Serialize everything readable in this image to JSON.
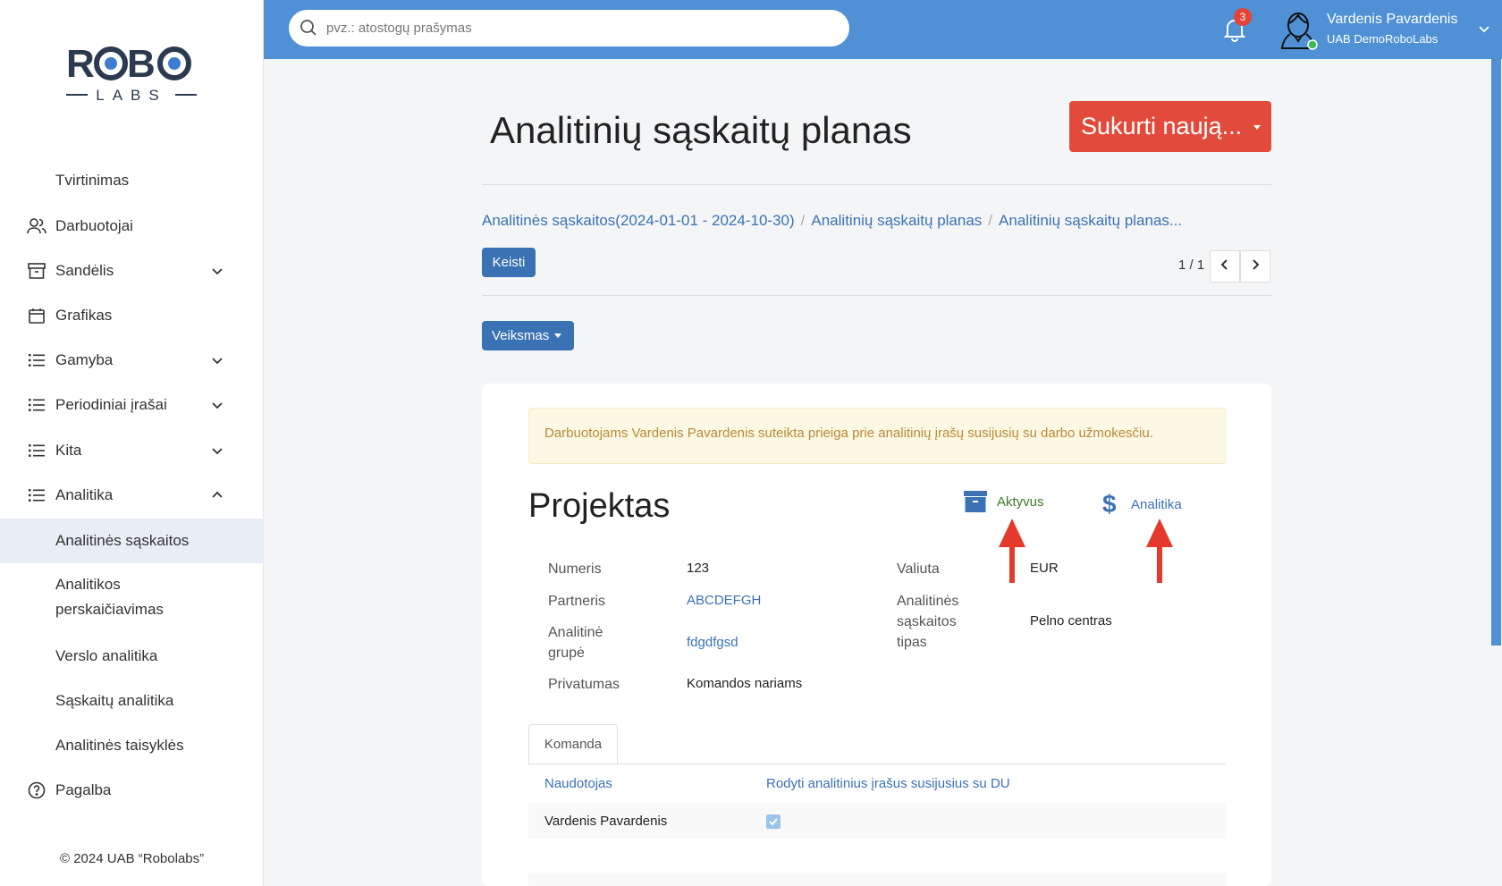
{
  "logo": {
    "line1": "ROBO",
    "line2": "LABS"
  },
  "sidebar": {
    "items": [
      {
        "label": "Tvirtinimas"
      },
      {
        "label": "Darbuotojai"
      },
      {
        "label": "Sandėlis"
      },
      {
        "label": "Grafikas"
      },
      {
        "label": "Gamyba"
      },
      {
        "label": "Periodiniai įrašai"
      },
      {
        "label": "Kita"
      },
      {
        "label": "Analitika"
      },
      {
        "label": "Analitinės sąskaitos"
      },
      {
        "label": "Analitikos perskaičiavimas"
      },
      {
        "label": "Verslo analitika"
      },
      {
        "label": "Sąskaitų analitika"
      },
      {
        "label": "Analitinės taisyklės"
      },
      {
        "label": "Pagalba"
      }
    ],
    "copyright": "© 2024 UAB “Robolabs”"
  },
  "topbar": {
    "search_placeholder": "pvz.: atostogų prašymas",
    "notifications_count": "3",
    "user_name": "Vardenis Pavardenis",
    "user_company": "UAB DemoRoboLabs"
  },
  "page": {
    "title": "Analitinių sąskaitų planas",
    "create_button": "Sukurti naują...",
    "breadcrumb": [
      "Analitinės sąskaitos(2024-01-01 - 2024-10-30)",
      "Analitinių sąskaitų planas",
      "Analitinių sąskaitų planas..."
    ],
    "edit_button": "Keisti",
    "pager": "1 / 1",
    "action_button": "Veiksmas"
  },
  "record": {
    "alert": "Darbuotojams Vardenis Pavardenis suteikta prieiga prie analitinių įrašų susijusių su darbo užmokesčiu.",
    "title": "Projektas",
    "status_label": "Aktyvus",
    "analytics_label": "Analitika",
    "fields": {
      "numeris_label": "Numeris",
      "numeris_value": "123",
      "partneris_label": "Partneris",
      "partneris_value": "ABCDEFGH",
      "grupe_label": "Analitinė grupė",
      "grupe_value": "fdgdfgsd",
      "privatumas_label": "Privatumas",
      "privatumas_value": "Komandos nariams",
      "valiuta_label": "Valiuta",
      "valiuta_value": "EUR",
      "tipas_label": "Analitinės sąskaitos tipas",
      "tipas_value": "Pelno centras"
    },
    "tab_label": "Komanda",
    "table": {
      "headers": [
        "Naudotojas",
        "Rodyti analitinius įrašus susijusius su DU"
      ],
      "rows": [
        {
          "user": "Vardenis Pavardenis",
          "checked": true
        }
      ]
    }
  },
  "colors": {
    "topbar": "#4f91d4",
    "accent": "#3a72b3",
    "create": "#e24a3b",
    "arrow": "#e53a2b"
  }
}
